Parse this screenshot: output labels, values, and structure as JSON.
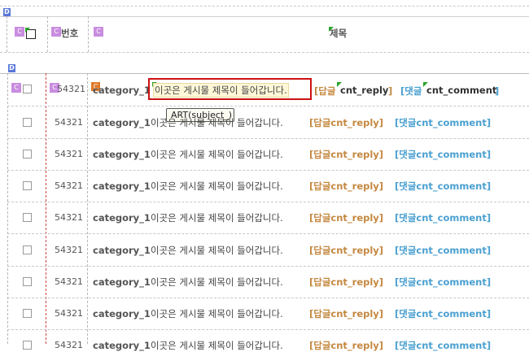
{
  "header": {
    "col_num": "번호",
    "col_title": "제목"
  },
  "badges": {
    "d": "D",
    "c": "C"
  },
  "rows": [
    {
      "num": "54321",
      "category": "category_1",
      "subject": "이곳은 게시물 제목이 들어갑니다.",
      "reply_prefix": "[답글",
      "reply_var": "cnt_reply",
      "reply_suffix": "]",
      "comment_prefix": "[댓글",
      "comment_var": "cnt_comment",
      "comment_suffix": "]"
    },
    {
      "num": "54321",
      "category": "category_1",
      "subject": "이곳은 게시물 제목이 들어갑니다.",
      "reply": "[답글cnt_reply]",
      "comment": "[댓글cnt_comment]"
    },
    {
      "num": "54321",
      "category": "category_1",
      "subject": "이곳은 게시물 제목이 들어갑니다.",
      "reply": "[답글cnt_reply]",
      "comment": "[댓글cnt_comment]"
    },
    {
      "num": "54321",
      "category": "category_1",
      "subject": "이곳은 게시물 제목이 들어갑니다.",
      "reply": "[답글cnt_reply]",
      "comment": "[댓글cnt_comment]"
    },
    {
      "num": "54321",
      "category": "category_1",
      "subject": "이곳은 게시물 제목이 들어갑니다.",
      "reply": "[답글cnt_reply]",
      "comment": "[댓글cnt_comment]"
    },
    {
      "num": "54321",
      "category": "category_1",
      "subject": "이곳은 게시물 제목이 들어갑니다.",
      "reply": "[답글cnt_reply]",
      "comment": "[댓글cnt_comment]"
    },
    {
      "num": "54321",
      "category": "category_1",
      "subject": "이곳은 게시물 제목이 들어갑니다.",
      "reply": "[답글cnt_reply]",
      "comment": "[댓글cnt_comment]"
    },
    {
      "num": "54321",
      "category": "category_1",
      "subject": "이곳은 게시물 제목이 들어갑니다.",
      "reply": "[답글cnt_reply]",
      "comment": "[댓글cnt_comment]"
    }
  ],
  "tooltip": "ART(subject_)",
  "colors": {
    "highlight": "#cc1111",
    "reply": "#c48840",
    "comment": "#4aa0d0"
  }
}
